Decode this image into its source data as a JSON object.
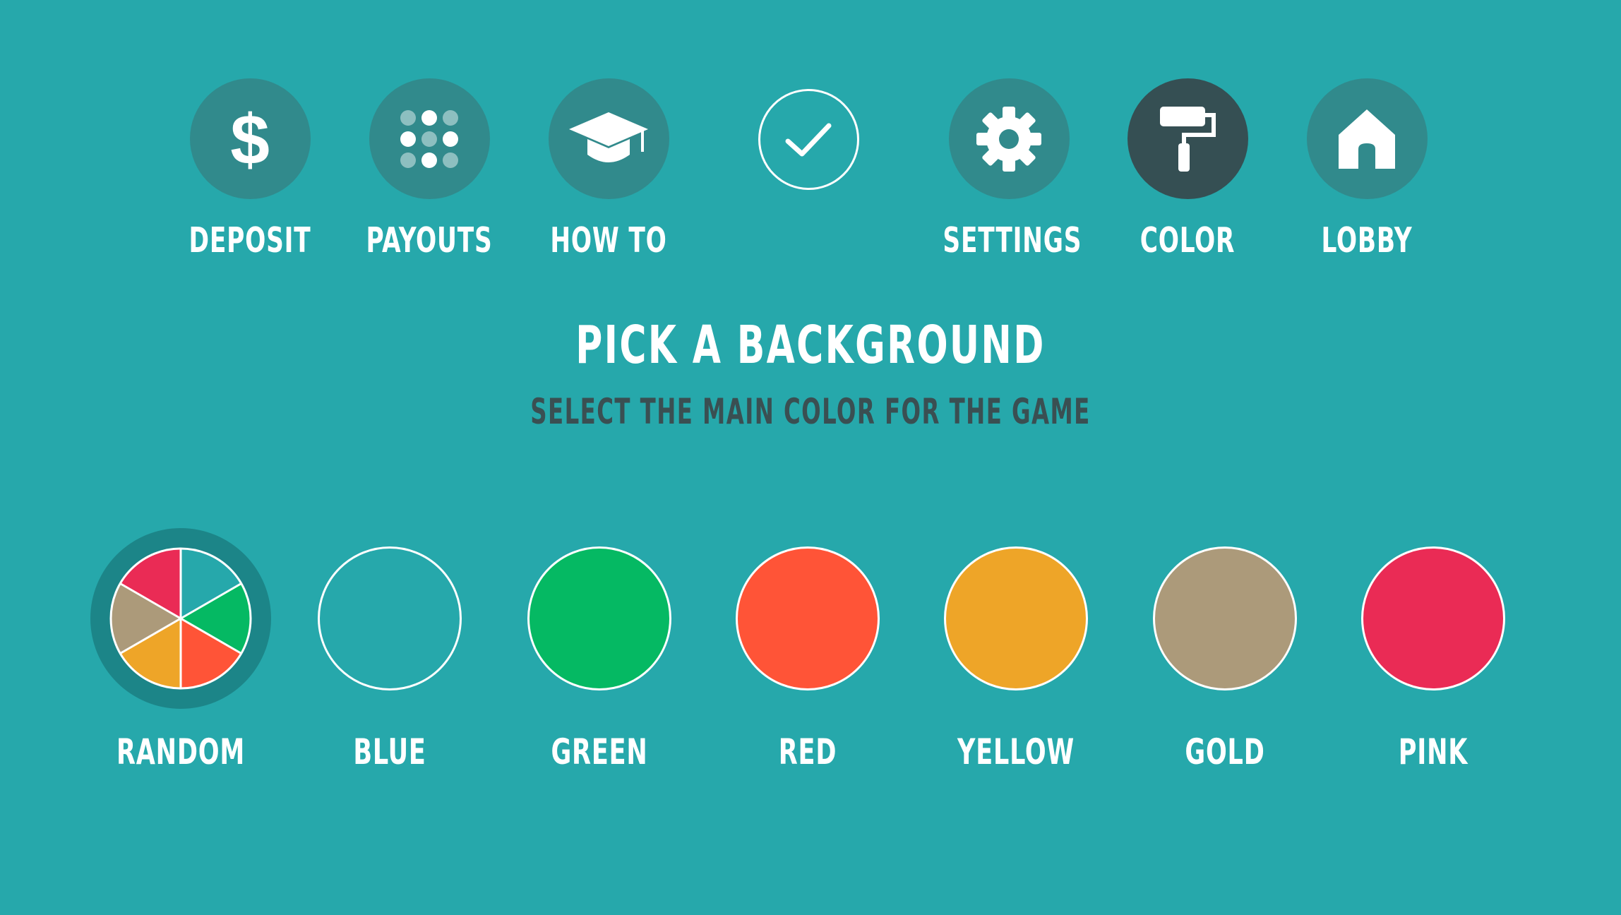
{
  "nav": {
    "items": [
      {
        "label": "DEPOSIT",
        "icon": "dollar-icon"
      },
      {
        "label": "PAYOUTS",
        "icon": "dots-grid-icon"
      },
      {
        "label": "HOW TO",
        "icon": "graduation-cap-icon"
      },
      {
        "label": "",
        "icon": "checkmark-icon"
      },
      {
        "label": "SETTINGS",
        "icon": "gear-icon"
      },
      {
        "label": "COLOR",
        "icon": "paint-roller-icon",
        "active": true
      },
      {
        "label": "LOBBY",
        "icon": "house-icon"
      }
    ]
  },
  "main": {
    "title": "PICK A BACKGROUND",
    "subtitle": "SELECT THE MAIN COLOR FOR THE GAME"
  },
  "swatches": [
    {
      "label": "RANDOM",
      "color": "multicolor",
      "selected": true
    },
    {
      "label": "BLUE",
      "color": "#26a8ab"
    },
    {
      "label": "GREEN",
      "color": "#05b963"
    },
    {
      "label": "RED",
      "color": "#ff5437"
    },
    {
      "label": "YELLOW",
      "color": "#eea528"
    },
    {
      "label": "GOLD",
      "color": "#ac9a7a"
    },
    {
      "label": "PINK",
      "color": "#ea2b55"
    }
  ],
  "colors": {
    "background": "#26a8ab",
    "nav_circle": "#318a8c",
    "nav_active": "#354f53",
    "subtitle": "#3a4f52"
  }
}
